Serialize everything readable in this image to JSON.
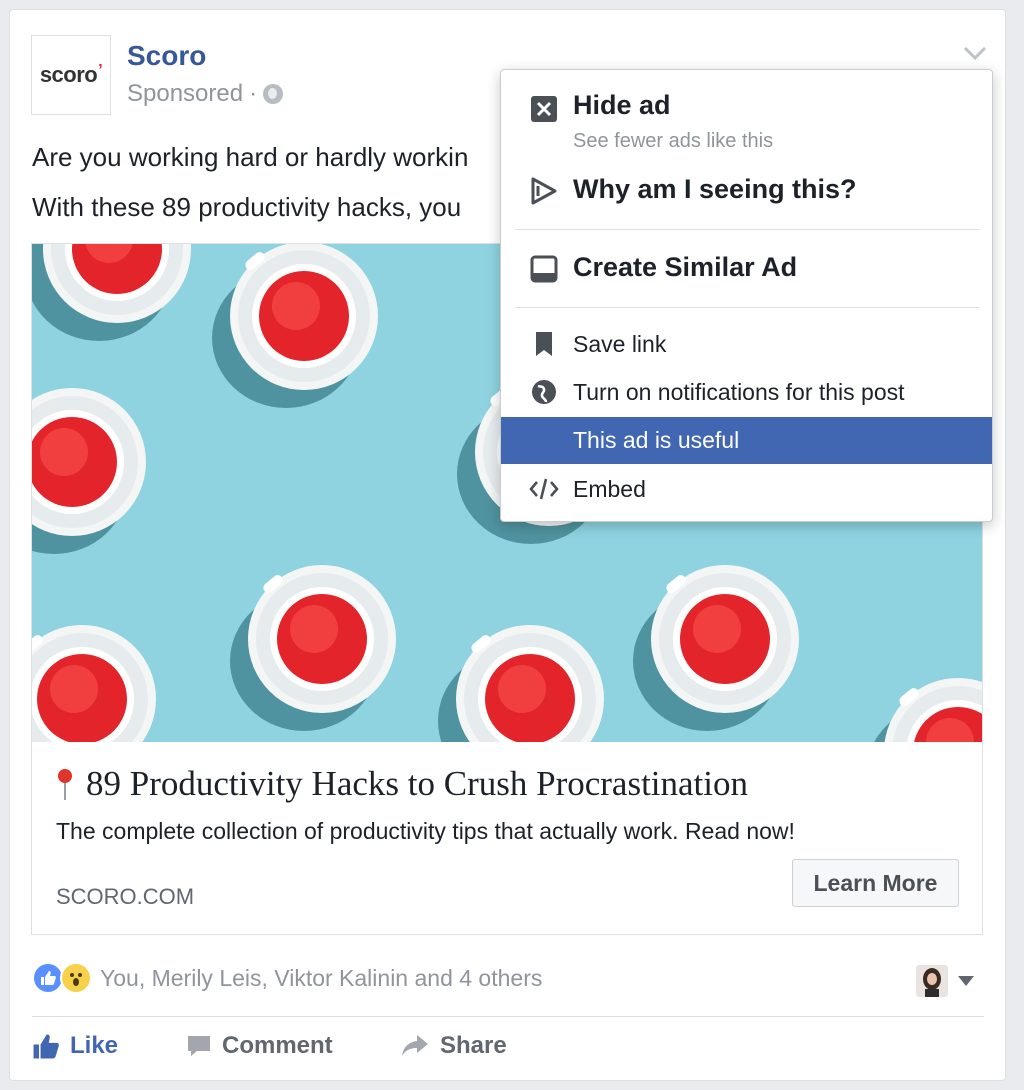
{
  "post": {
    "page_name": "Scoro",
    "logo_text": "scoro",
    "sponsored": "Sponsored",
    "separator": "·",
    "body_line1": "Are you working hard or hardly workin",
    "body_line2": "With these 89 productivity hacks, you"
  },
  "link": {
    "title": "89 Productivity Hacks to Crush Procrastination",
    "description": "The complete collection of productivity tips that actually work. Read now!",
    "domain": "SCORO.COM",
    "cta": "Learn More"
  },
  "reactions": {
    "summary": "You, Merily Leis, Viktor Kalinin and 4 others"
  },
  "actions": {
    "like": "Like",
    "comment": "Comment",
    "share": "Share"
  },
  "menu": {
    "hide_ad": "Hide ad",
    "hide_ad_sub": "See fewer ads like this",
    "why": "Why am I seeing this?",
    "create_similar": "Create Similar Ad",
    "save_link": "Save link",
    "notifications": "Turn on notifications for this post",
    "useful": "This ad is useful",
    "embed": "Embed"
  },
  "colors": {
    "brand_blue": "#365899",
    "highlight": "#4267b2",
    "hero_bg": "#8fd3e0",
    "tea_red": "#e3252b"
  }
}
